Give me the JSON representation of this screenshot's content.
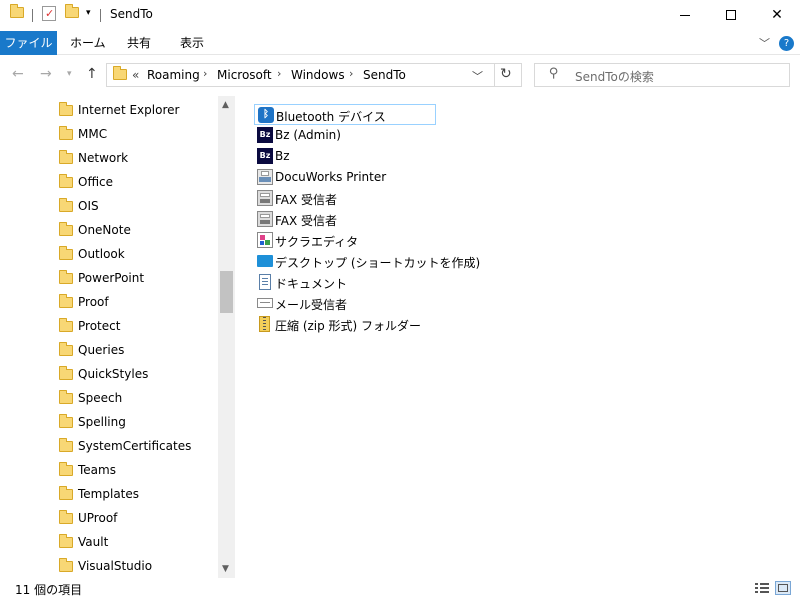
{
  "titlebar": {
    "title": "SendTo",
    "minimize": "—",
    "maximize": "☐",
    "close": "✕"
  },
  "ribbon": {
    "tabs": [
      "ファイル",
      "ホーム",
      "共有",
      "表示"
    ]
  },
  "address": {
    "overflow": "«",
    "crumbs": [
      "Roaming",
      "Microsoft",
      "Windows",
      "SendTo"
    ],
    "search_placeholder": "SendToの検索"
  },
  "nav": {
    "items": [
      "Internet Explorer",
      "MMC",
      "Network",
      "Office",
      "OIS",
      "OneNote",
      "Outlook",
      "PowerPoint",
      "Proof",
      "Protect",
      "Queries",
      "QuickStyles",
      "Speech",
      "Spelling",
      "SystemCertificates",
      "Teams",
      "Templates",
      "UProof",
      "Vault",
      "VisualStudio"
    ]
  },
  "files": [
    {
      "name": "Bluetooth デバイス",
      "icon": "bluetooth-icon"
    },
    {
      "name": "Bz (Admin)",
      "icon": "bz-app-icon"
    },
    {
      "name": "Bz",
      "icon": "bz-app-icon"
    },
    {
      "name": "DocuWorks Printer",
      "icon": "printer-icon"
    },
    {
      "name": "FAX 受信者",
      "icon": "fax-icon"
    },
    {
      "name": "FAX 受信者",
      "icon": "fax-icon"
    },
    {
      "name": "サクラエディタ",
      "icon": "sakura-editor-icon"
    },
    {
      "name": "デスクトップ (ショートカットを作成)",
      "icon": "desktop-icon"
    },
    {
      "name": "ドキュメント",
      "icon": "document-icon"
    },
    {
      "name": "メール受信者",
      "icon": "mail-icon"
    },
    {
      "name": "圧縮 (zip 形式) フォルダー",
      "icon": "zip-folder-icon"
    }
  ],
  "status": {
    "count": "11 個の項目"
  },
  "colors": {
    "accent": "#1979ca",
    "selection_border": "#99d1ff",
    "folder": "#f8d775"
  }
}
